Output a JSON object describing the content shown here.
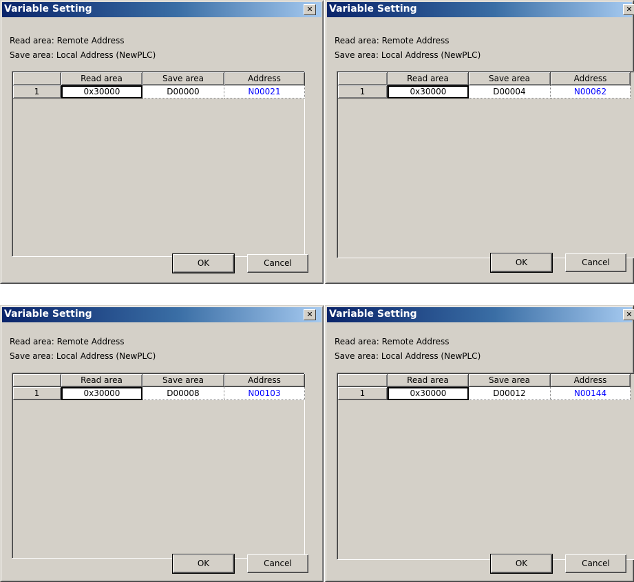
{
  "dialogs": [
    {
      "title": "Variable Setting",
      "close_glyph": "✕",
      "read_info": "Read area: Remote Address",
      "save_info": "Save area: Local Address (NewPLC)",
      "columns": [
        "Read area",
        "Save area",
        "Address"
      ],
      "rows": [
        {
          "index": "1",
          "read": "0x30000",
          "save": "D00000",
          "address": "N00021"
        }
      ],
      "ok": "OK",
      "cancel": "Cancel"
    },
    {
      "title": "Variable Setting",
      "close_glyph": "✕",
      "read_info": "Read area: Remote Address",
      "save_info": "Save area: Local Address (NewPLC)",
      "columns": [
        "Read area",
        "Save area",
        "Address"
      ],
      "rows": [
        {
          "index": "1",
          "read": "0x30000",
          "save": "D00004",
          "address": "N00062"
        }
      ],
      "ok": "OK",
      "cancel": "Cancel"
    },
    {
      "title": "Variable Setting",
      "close_glyph": "✕",
      "read_info": "Read area: Remote Address",
      "save_info": "Save area: Local Address (NewPLC)",
      "columns": [
        "Read area",
        "Save area",
        "Address"
      ],
      "rows": [
        {
          "index": "1",
          "read": "0x30000",
          "save": "D00008",
          "address": "N00103"
        }
      ],
      "ok": "OK",
      "cancel": "Cancel"
    },
    {
      "title": "Variable Setting",
      "close_glyph": "✕",
      "read_info": "Read area: Remote Address",
      "save_info": "Save area: Local Address (NewPLC)",
      "columns": [
        "Read area",
        "Save area",
        "Address"
      ],
      "rows": [
        {
          "index": "1",
          "read": "0x30000",
          "save": "D00012",
          "address": "N00144"
        }
      ],
      "ok": "OK",
      "cancel": "Cancel"
    }
  ],
  "colors": {
    "titlebar_start": "#0a246a",
    "titlebar_end": "#a6caf0",
    "face": "#d4d0c8",
    "address_text": "#0000ff"
  }
}
